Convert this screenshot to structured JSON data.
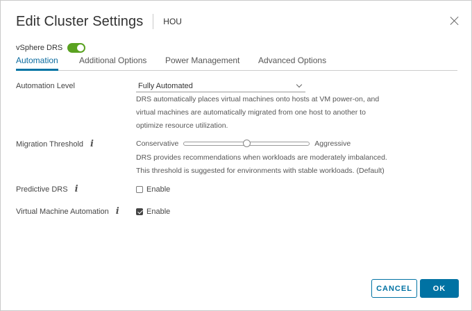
{
  "dialog": {
    "title": "Edit Cluster Settings",
    "subtitle": "HOU"
  },
  "drs": {
    "label": "vSphere DRS",
    "enabled": true
  },
  "tabs": [
    {
      "label": "Automation",
      "active": true
    },
    {
      "label": "Additional Options",
      "active": false
    },
    {
      "label": "Power Management",
      "active": false
    },
    {
      "label": "Advanced Options",
      "active": false
    }
  ],
  "automation_level": {
    "label": "Automation Level",
    "selected": "Fully Automated",
    "description": [
      "DRS automatically places virtual machines onto hosts at VM power-on, and",
      "virtual machines are automatically migrated from one host to another to",
      "optimize resource utilization."
    ]
  },
  "migration_threshold": {
    "label": "Migration Threshold",
    "min_label": "Conservative",
    "max_label": "Aggressive",
    "level": 3,
    "levels": 5,
    "description": [
      "DRS provides recommendations when workloads are moderately imbalanced.",
      "This threshold is suggested for environments with stable workloads. (Default)"
    ]
  },
  "predictive_drs": {
    "label": "Predictive DRS",
    "checkbox_label": "Enable",
    "checked": false
  },
  "vm_automation": {
    "label": "Virtual Machine Automation",
    "checkbox_label": "Enable",
    "checked": true
  },
  "buttons": {
    "cancel": "CANCEL",
    "ok": "OK"
  },
  "colors": {
    "accent": "#0072a3",
    "toggle_on": "#5aa220"
  },
  "icons": {
    "close": "close-icon",
    "info": "info-icon",
    "dropdown": "chevron-down-icon"
  }
}
